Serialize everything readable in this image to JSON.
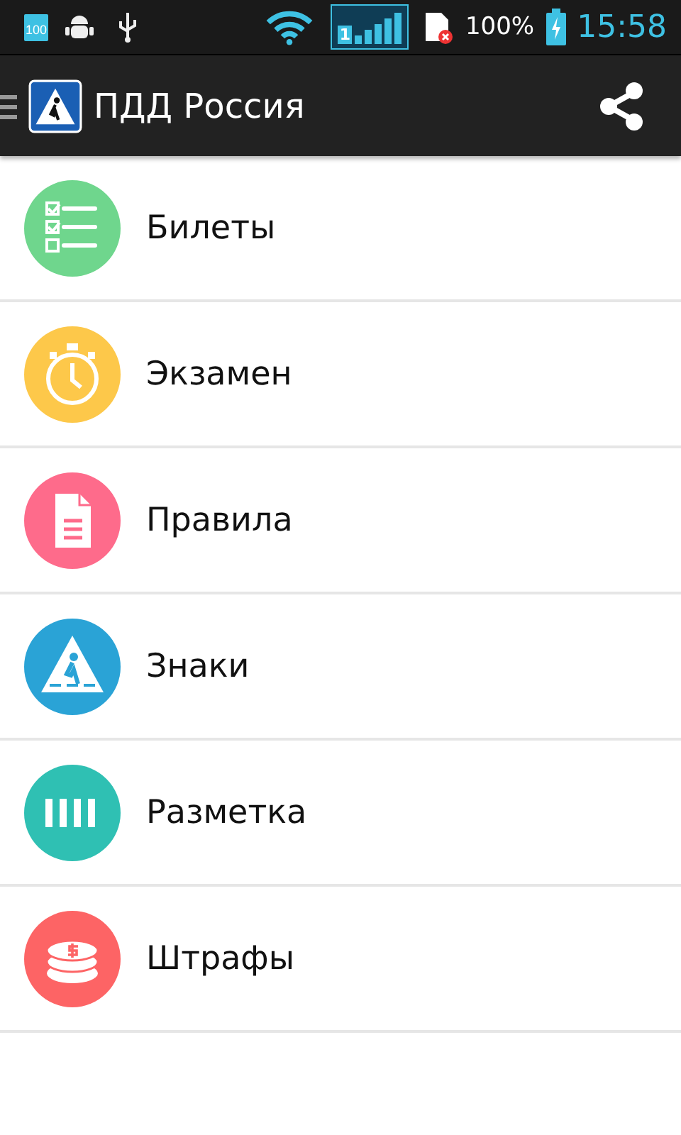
{
  "status_bar": {
    "battery_icon_label": "100",
    "signal_sim": "1",
    "battery_percent": "100%",
    "time": "15:58"
  },
  "app_bar": {
    "title": "ПДД Россия"
  },
  "menu": [
    {
      "kind": "tickets",
      "label": "Билеты",
      "color": "#6fd68d"
    },
    {
      "kind": "exam",
      "label": "Экзамен",
      "color": "#fdc84a"
    },
    {
      "kind": "rules",
      "label": "Правила",
      "color": "#fe6b8b"
    },
    {
      "kind": "signs",
      "label": "Знаки",
      "color": "#2aa3d6"
    },
    {
      "kind": "markings",
      "label": "Разметка",
      "color": "#2fc0b3"
    },
    {
      "kind": "fines",
      "label": "Штрафы",
      "color": "#fd6465"
    }
  ]
}
